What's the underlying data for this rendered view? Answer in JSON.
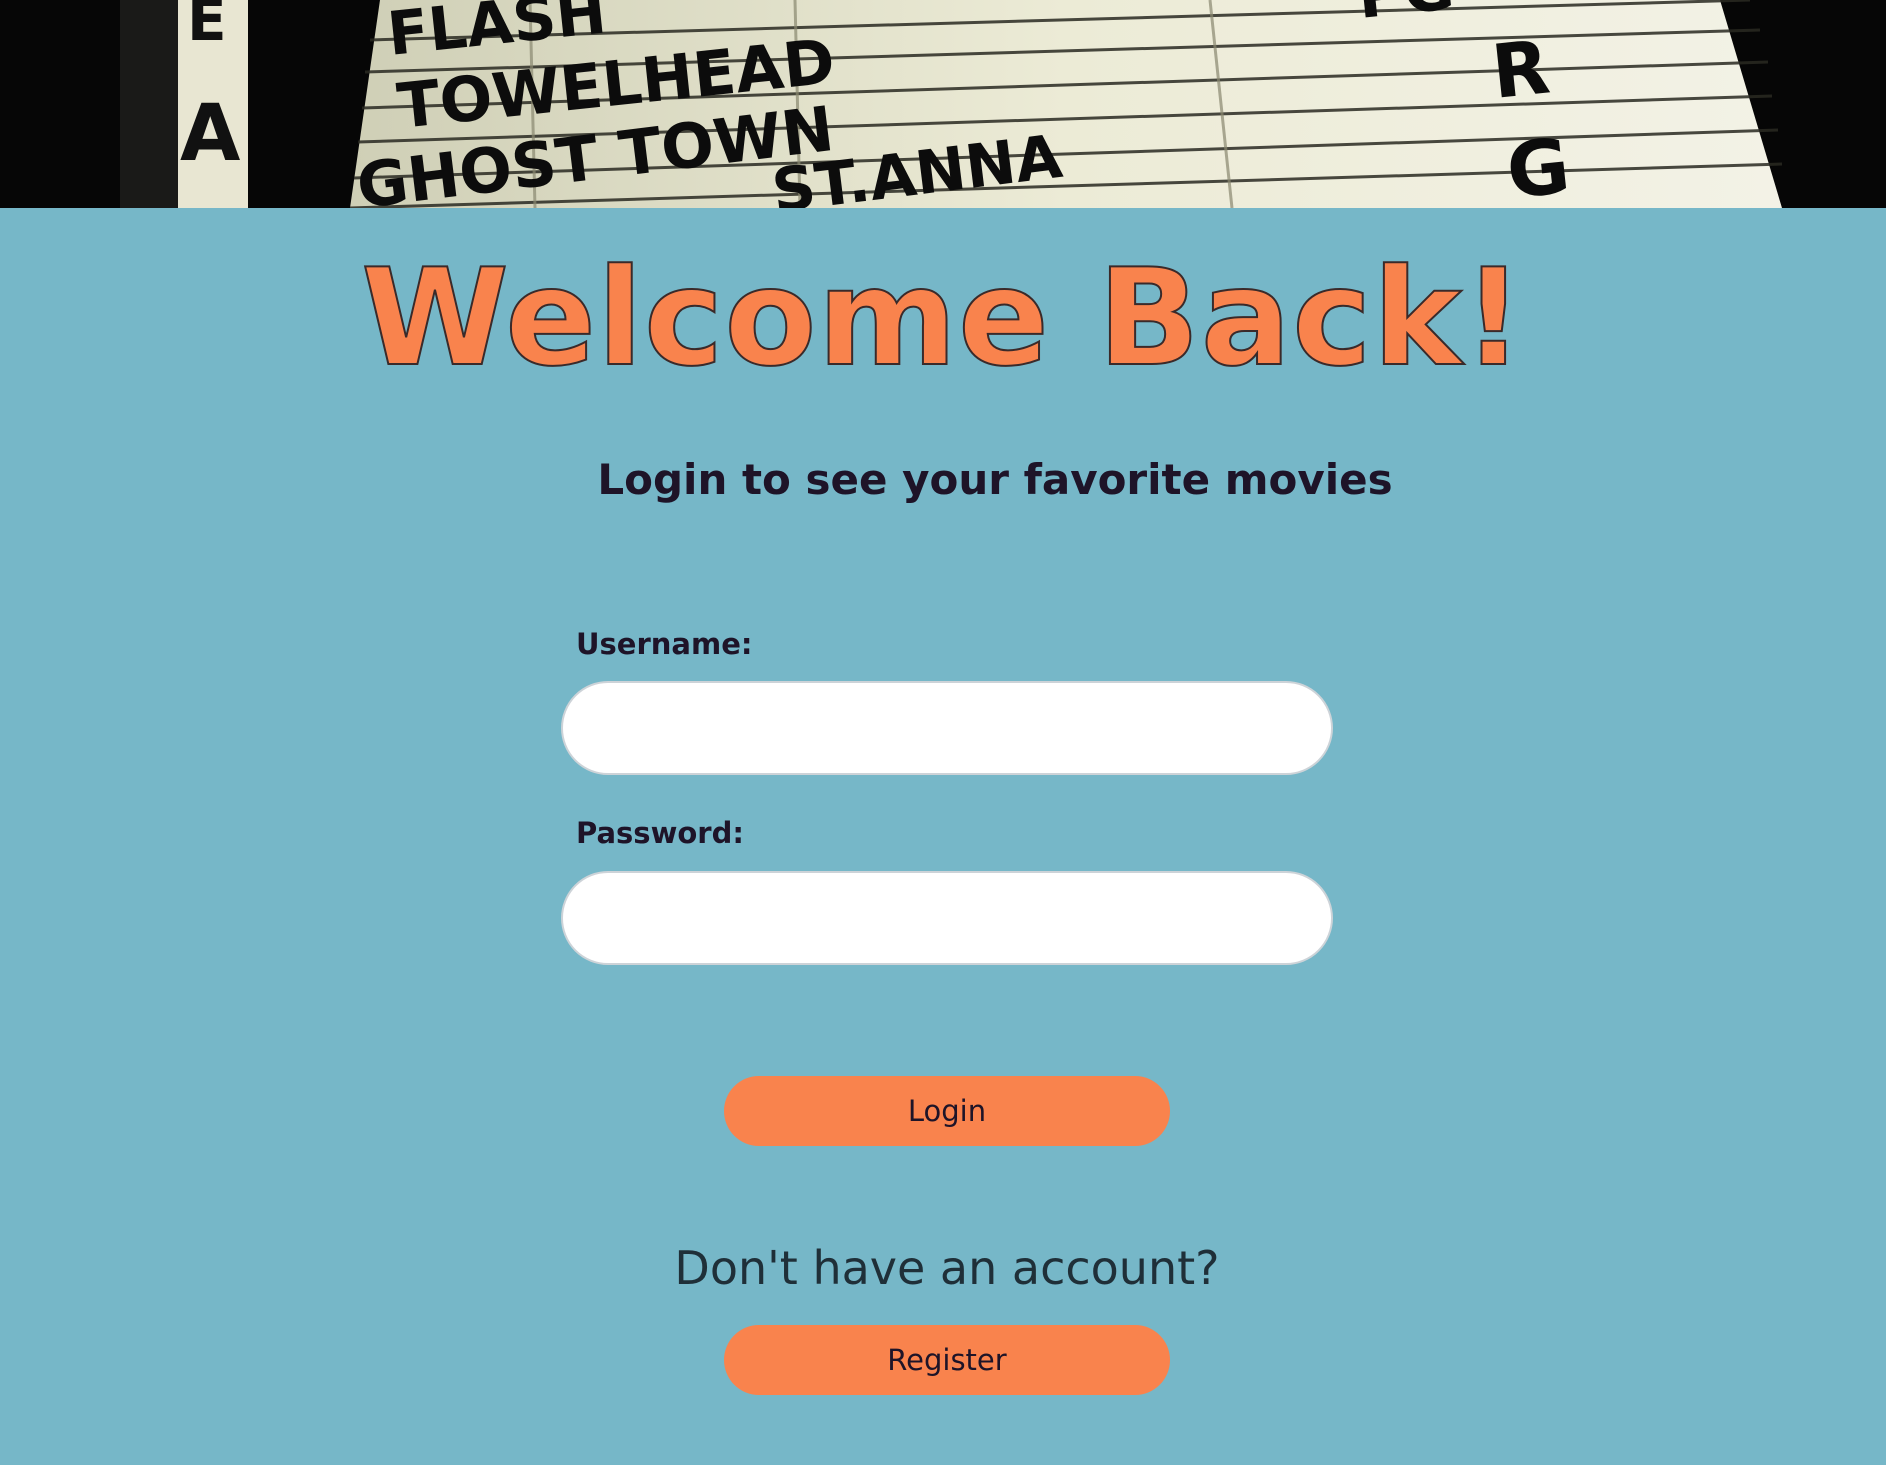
{
  "banner": {
    "marquee_lines": [
      "FLASH",
      "TOWELHEAD",
      "GHOST TOWN",
      "ST.ANNA"
    ],
    "ratings": [
      "PG",
      "R",
      "G"
    ],
    "left_letters": [
      "E",
      "A"
    ]
  },
  "welcome": {
    "title": "Welcome Back!",
    "subtitle": "Login to see your favorite movies"
  },
  "form": {
    "username_label": "Username:",
    "username_value": "",
    "password_label": "Password:",
    "password_value": "",
    "login_label": "Login"
  },
  "register": {
    "prompt": "Don't have an account?",
    "button_label": "Register"
  },
  "colors": {
    "background": "#76b7c8",
    "accent": "#f9834d",
    "text_dark": "#1e1428"
  }
}
